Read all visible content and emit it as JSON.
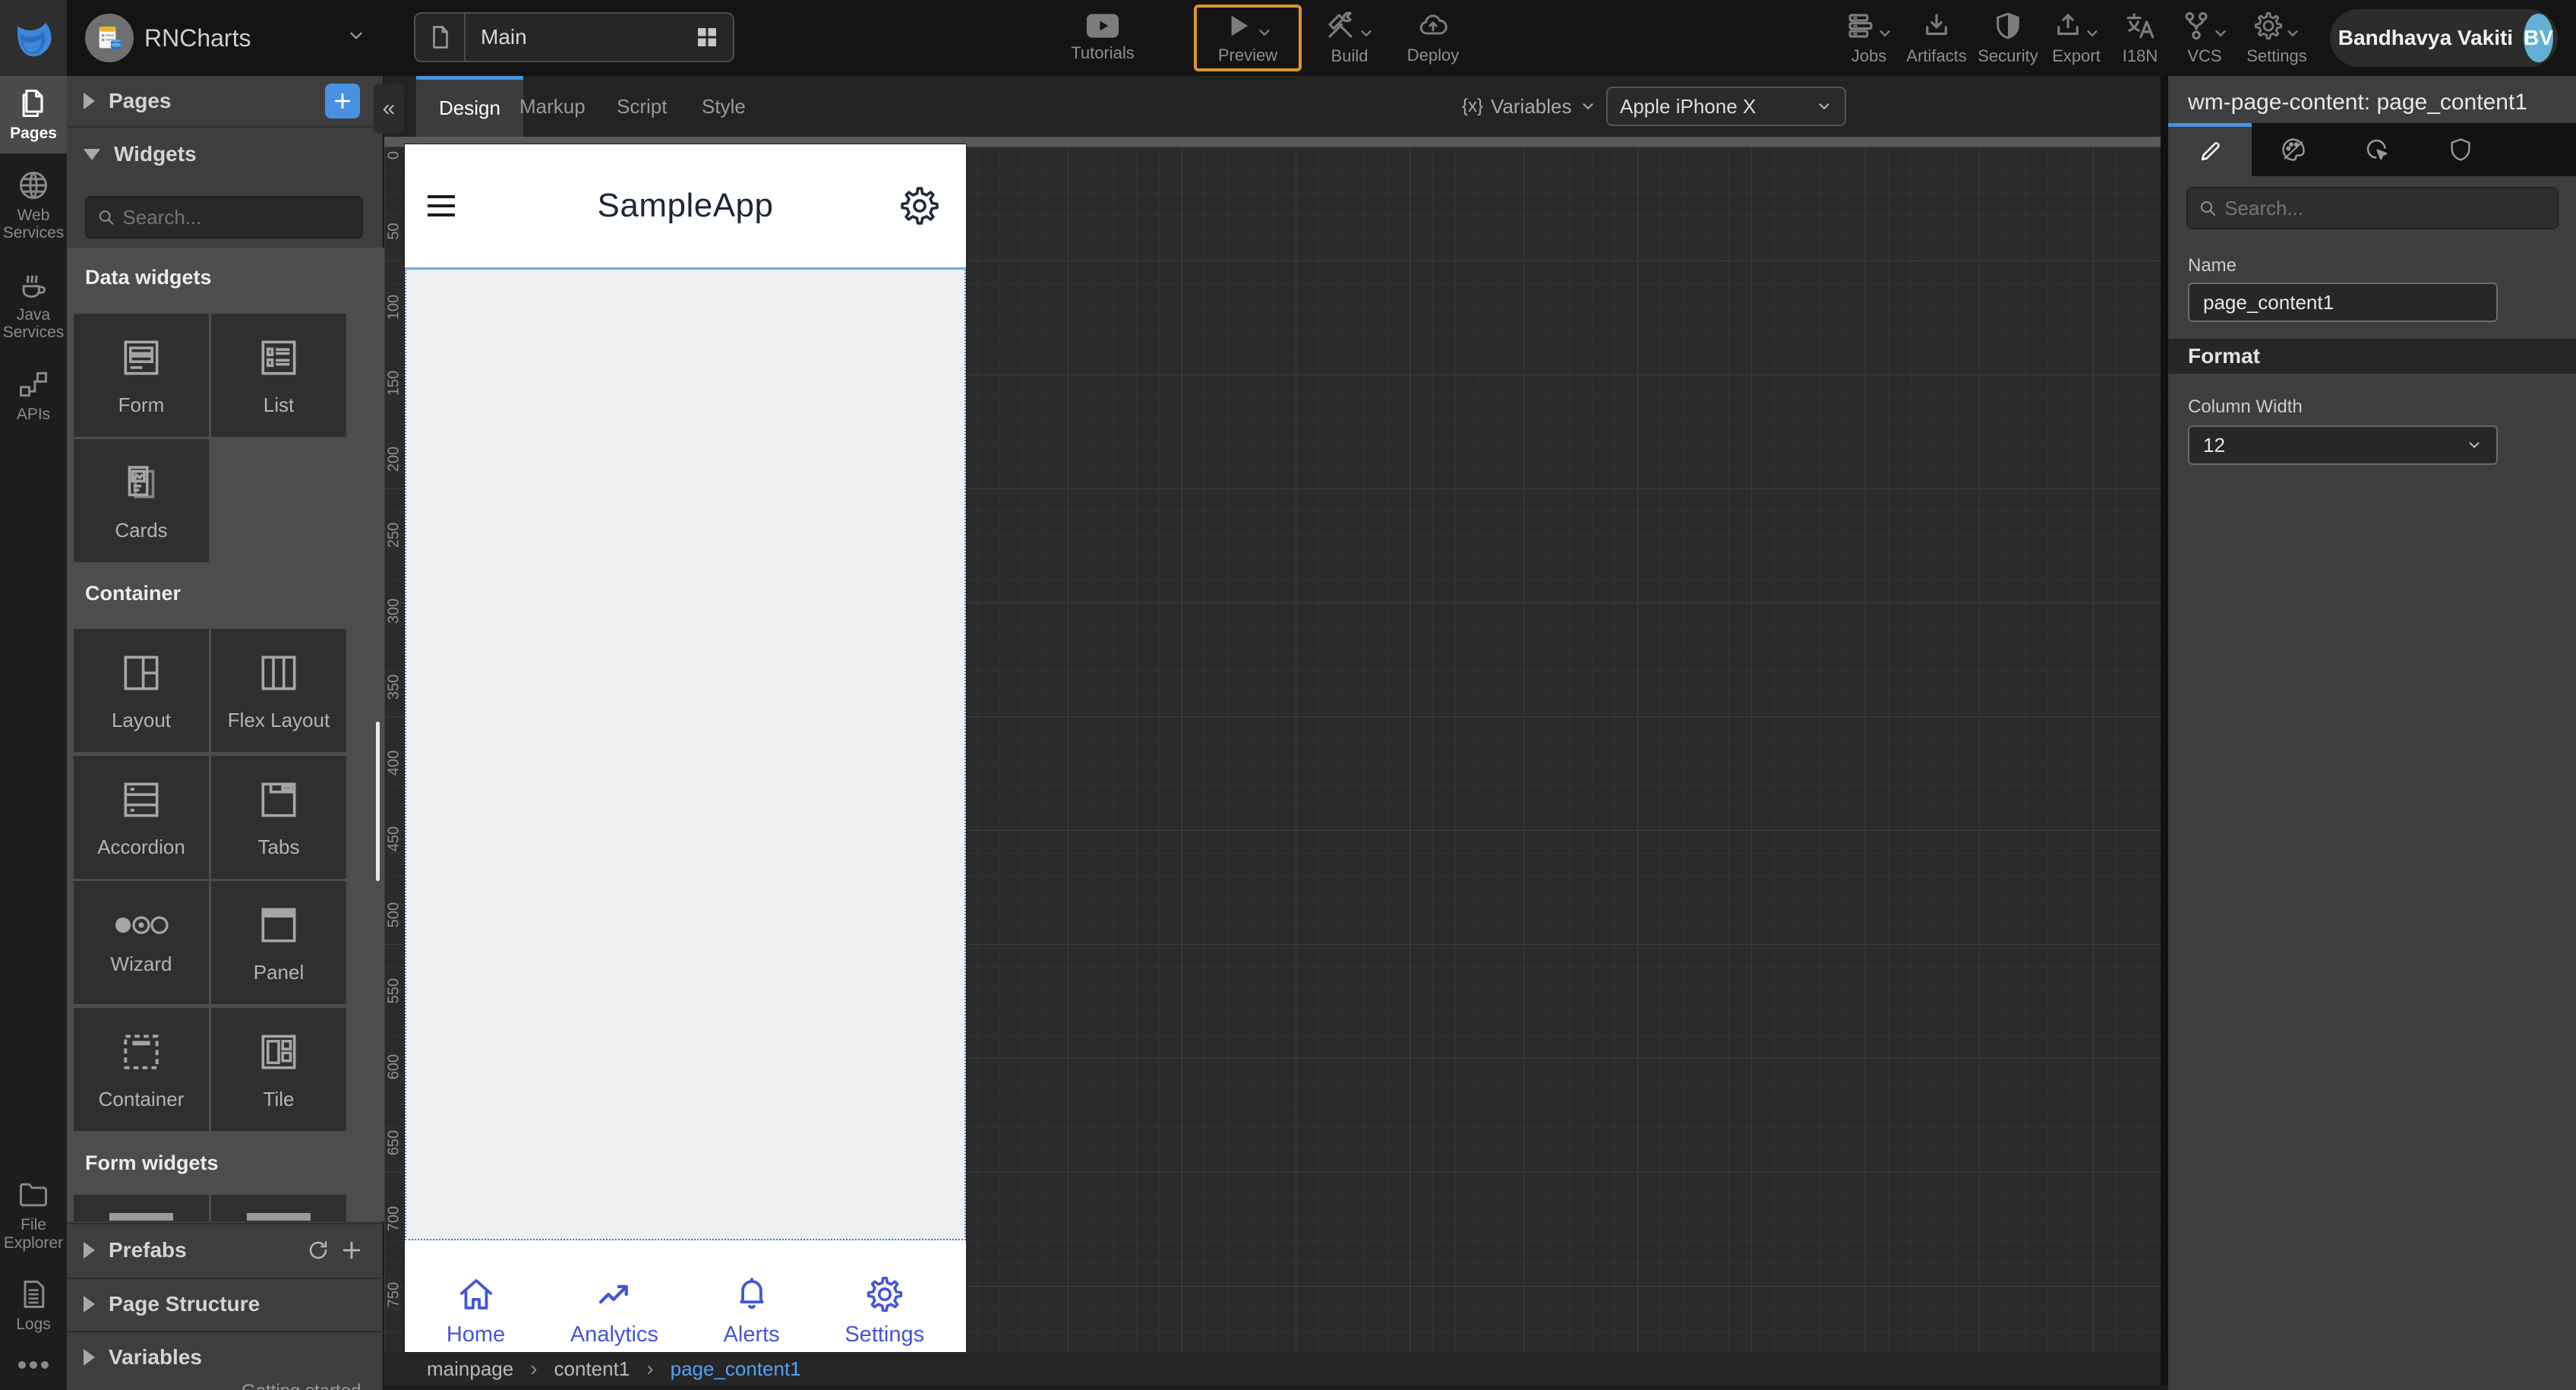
{
  "topbar": {
    "project_name": "RNCharts",
    "page_select_value": "Main",
    "tutorials_label": "Tutorials",
    "preview_label": "Preview",
    "build_label": "Build",
    "deploy_label": "Deploy",
    "jobs_label": "Jobs",
    "artifacts_label": "Artifacts",
    "security_label": "Security",
    "export_label": "Export",
    "i18n_label": "I18N",
    "vcs_label": "VCS",
    "settings_label": "Settings",
    "user": {
      "name": "Bandhavya Vakiti",
      "initials": "BV"
    }
  },
  "rail": {
    "pages": "Pages",
    "web_services": "Web Services",
    "java_services": "Java Services",
    "apis": "APIs",
    "file_explorer": "File Explorer",
    "logs": "Logs"
  },
  "left_panel": {
    "pages_title": "Pages",
    "widgets_title": "Widgets",
    "search_placeholder": "Search...",
    "groups": [
      {
        "label": "Data widgets",
        "tiles": [
          "Form",
          "List",
          "Cards"
        ]
      },
      {
        "label": "Container",
        "tiles": [
          "Layout",
          "Flex Layout",
          "Accordion",
          "Tabs",
          "Wizard",
          "Panel",
          "Container",
          "Tile"
        ]
      },
      {
        "label": "Form widgets",
        "tiles": []
      }
    ],
    "prefabs_title": "Prefabs",
    "page_structure_title": "Page Structure",
    "variables_title": "Variables",
    "cutoff_footer_text": "Getting started"
  },
  "canvas": {
    "tabs": [
      "Design",
      "Markup",
      "Script",
      "Style"
    ],
    "active_tab": "Design",
    "variables_button": "Variables",
    "variables_prefix": "{x}",
    "device_value": "Apple iPhone X",
    "ruler_values": [
      "0",
      "50",
      "100",
      "150",
      "200",
      "250",
      "300",
      "350",
      "400",
      "450",
      "500",
      "550",
      "600",
      "650",
      "700",
      "750"
    ],
    "breadcrumb": [
      "mainpage",
      "content1",
      "page_content1"
    ]
  },
  "phone": {
    "title": "SampleApp",
    "nav": [
      {
        "label": "Home"
      },
      {
        "label": "Analytics"
      },
      {
        "label": "Alerts"
      },
      {
        "label": "Settings"
      }
    ]
  },
  "right_panel": {
    "title": "wm-page-content: page_content1",
    "search_placeholder": "Search...",
    "name_label": "Name",
    "name_value": "page_content1",
    "format_label": "Format",
    "column_width_label": "Column Width",
    "column_width_value": "12"
  },
  "colors": {
    "accent": "#4a90e2",
    "preview_highlight": "#d9942f",
    "phone_nav_blue": "#4356d6",
    "breadcrumb_active": "#55a1f0"
  }
}
